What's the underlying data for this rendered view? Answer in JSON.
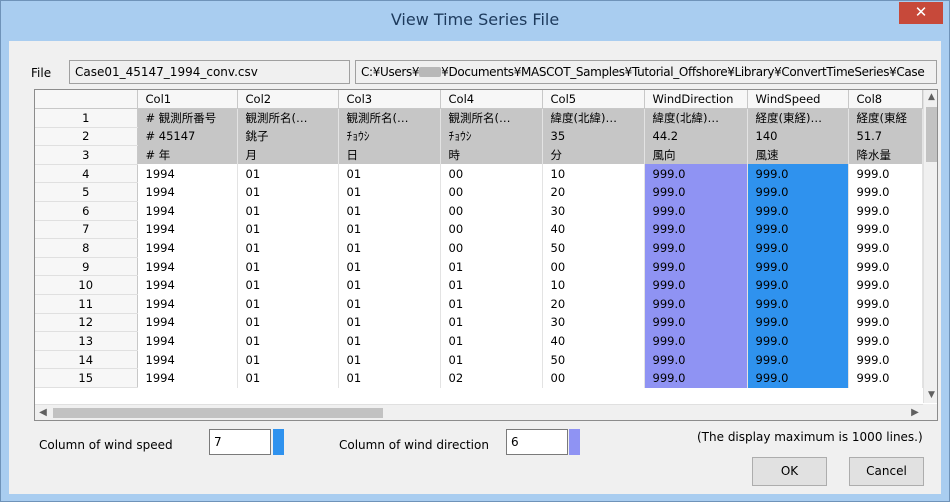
{
  "window": {
    "title": "View Time Series File",
    "close_glyph": "✕"
  },
  "file": {
    "label": "File",
    "name": "Case01_45147_1994_conv.csv",
    "path_prefix": "C:¥Users¥",
    "path_suffix": "¥Documents¥MASCOT_Samples¥Tutorial_Offshore¥Library¥ConvertTimeSeries¥Case"
  },
  "grid": {
    "columns": [
      "",
      "Col1",
      "Col2",
      "Col3",
      "Col4",
      "Col5",
      "WindDirection",
      "WindSpeed",
      "Col8"
    ],
    "rows": [
      [
        "1",
        "# 観測所番号",
        "観測所名(…",
        "観測所名(…",
        "観測所名(…",
        "緯度(北緯)…",
        "緯度(北緯)…",
        "経度(東経)…",
        "経度(東経"
      ],
      [
        "2",
        "# 45147",
        "銚子",
        "ﾁｮｳｼ",
        "ﾁｮｳｼ",
        "35",
        "44.2",
        "140",
        "51.7"
      ],
      [
        "3",
        "# 年",
        "月",
        "日",
        "時",
        "分",
        "風向",
        "風速",
        "降水量"
      ],
      [
        "4",
        "1994",
        "01",
        "01",
        "00",
        "10",
        "999.0",
        "999.0",
        "999.0"
      ],
      [
        "5",
        "1994",
        "01",
        "01",
        "00",
        "20",
        "999.0",
        "999.0",
        "999.0"
      ],
      [
        "6",
        "1994",
        "01",
        "01",
        "00",
        "30",
        "999.0",
        "999.0",
        "999.0"
      ],
      [
        "7",
        "1994",
        "01",
        "01",
        "00",
        "40",
        "999.0",
        "999.0",
        "999.0"
      ],
      [
        "8",
        "1994",
        "01",
        "01",
        "00",
        "50",
        "999.0",
        "999.0",
        "999.0"
      ],
      [
        "9",
        "1994",
        "01",
        "01",
        "01",
        "00",
        "999.0",
        "999.0",
        "999.0"
      ],
      [
        "10",
        "1994",
        "01",
        "01",
        "01",
        "10",
        "999.0",
        "999.0",
        "999.0"
      ],
      [
        "11",
        "1994",
        "01",
        "01",
        "01",
        "20",
        "999.0",
        "999.0",
        "999.0"
      ],
      [
        "12",
        "1994",
        "01",
        "01",
        "01",
        "30",
        "999.0",
        "999.0",
        "999.0"
      ],
      [
        "13",
        "1994",
        "01",
        "01",
        "01",
        "40",
        "999.0",
        "999.0",
        "999.0"
      ],
      [
        "14",
        "1994",
        "01",
        "01",
        "01",
        "50",
        "999.0",
        "999.0",
        "999.0"
      ],
      [
        "15",
        "1994",
        "01",
        "01",
        "02",
        "00",
        "999.0",
        "999.0",
        "999.0"
      ]
    ],
    "header_row_count": 3,
    "wind_direction_column_color": "#8f93f3",
    "wind_speed_column_color": "#2f92ee"
  },
  "controls": {
    "wind_speed_label": "Column of wind speed",
    "wind_speed_value": "7",
    "wind_direction_label": "Column of wind direction",
    "wind_direction_value": "6",
    "note": "(The display maximum is 1000 lines.)",
    "ok_label": "OK",
    "cancel_label": "Cancel"
  },
  "icons": {
    "scroll_up": "▲",
    "scroll_down": "▼",
    "scroll_left": "◀",
    "scroll_right": "▶"
  }
}
